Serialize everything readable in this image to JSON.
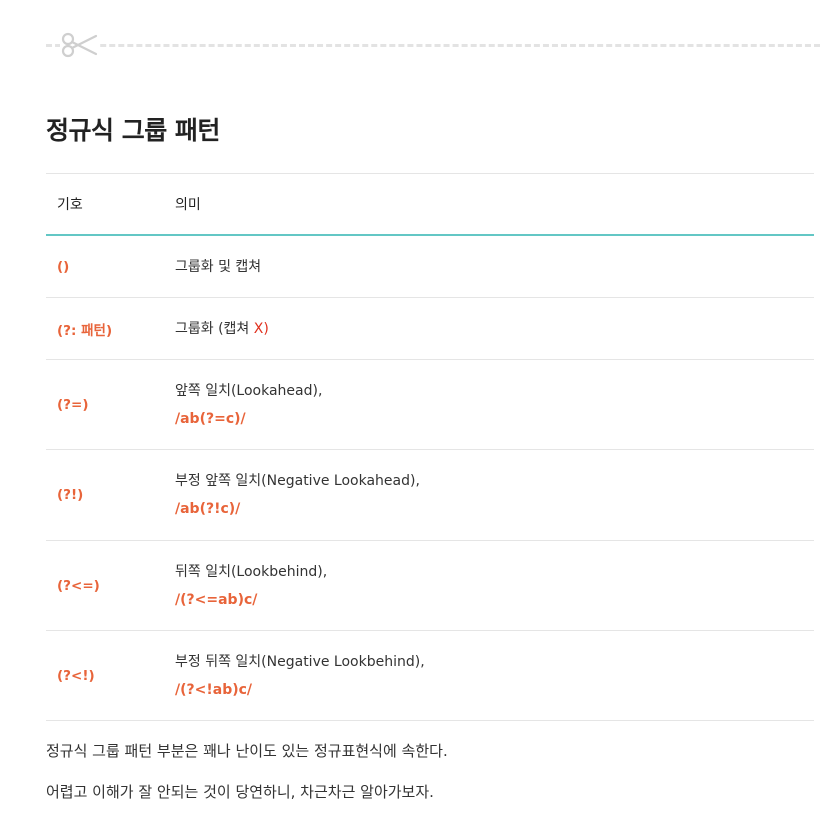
{
  "title": "정규식 그룹 패턴",
  "table": {
    "headers": [
      "기호",
      "의미"
    ],
    "rows": [
      {
        "symbol": "()",
        "desc": "그룹화 및 캡쳐",
        "suffix": "",
        "example": ""
      },
      {
        "symbol": "(?: 패턴)",
        "desc": "그룹화 (캡쳐 ",
        "suffix": "X)",
        "example": ""
      },
      {
        "symbol": "(?=)",
        "desc": "앞쪽 일치(Lookahead),",
        "suffix": "",
        "example": "/ab(?=c)/"
      },
      {
        "symbol": "(?!)",
        "desc": "부정 앞쪽 일치(Negative Lookahead),",
        "suffix": "",
        "example": "/ab(?!c)/"
      },
      {
        "symbol": "(?<=)",
        "desc": "뒤쪽 일치(Lookbehind),",
        "suffix": "",
        "example": "/(?<=ab)c/"
      },
      {
        "symbol": "(?<!)",
        "desc": "부정 뒤쪽 일치(Negative Lookbehind),",
        "suffix": "",
        "example": "/(?<!ab)c/"
      }
    ]
  },
  "paragraphs": [
    "정규식 그룹 패턴 부분은 꽤나 난이도 있는 정규표현식에 속한다.",
    "어렵고 이해가 잘 안되는 것이 당연하니, 차근차근 알아가보자."
  ],
  "colors": {
    "accent_line": "#63c7c5",
    "symbol": "#e8643a",
    "highlight_red": "#e0301e",
    "divider": "#e3e3e3"
  },
  "icons": {
    "divider": "scissors-icon"
  }
}
